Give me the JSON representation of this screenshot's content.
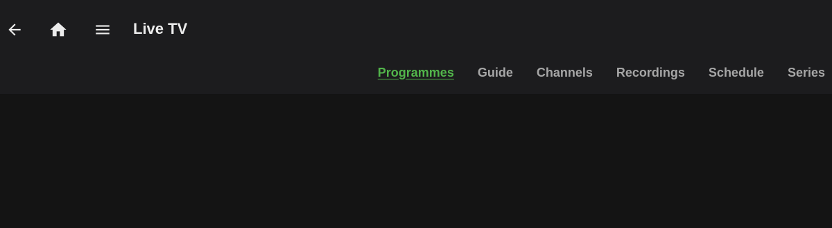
{
  "header": {
    "title": "Live TV",
    "icons": {
      "back": "arrow-back-icon",
      "home": "home-icon",
      "menu": "hamburger-menu-icon"
    }
  },
  "tabs": [
    {
      "label": "Programmes",
      "active": true
    },
    {
      "label": "Guide",
      "active": false
    },
    {
      "label": "Channels",
      "active": false
    },
    {
      "label": "Recordings",
      "active": false
    },
    {
      "label": "Schedule",
      "active": false
    },
    {
      "label": "Series",
      "active": false
    }
  ],
  "colors": {
    "accent": "#52b54b",
    "header_bg": "#1c1c1e",
    "page_bg": "#141414",
    "tab_text": "#a6a6a6",
    "title_text": "#ececec"
  }
}
